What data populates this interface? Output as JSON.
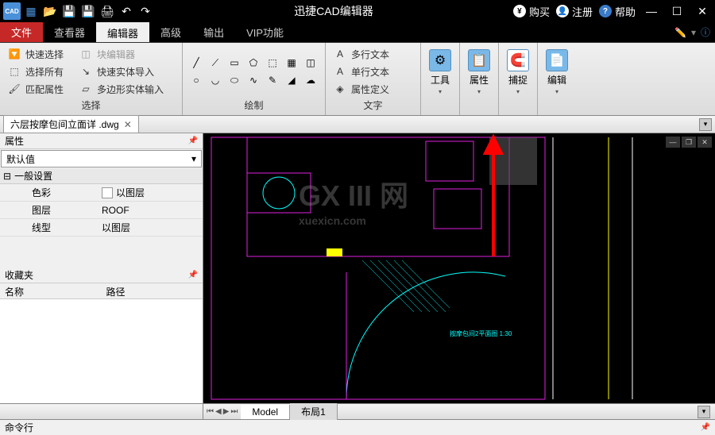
{
  "titlebar": {
    "app_icon": "CAD",
    "title": "迅捷CAD编辑器",
    "buy": "购买",
    "register": "注册",
    "help": "帮助"
  },
  "menu": {
    "file": "文件",
    "viewer": "查看器",
    "editor": "编辑器",
    "advanced": "高级",
    "output": "输出",
    "vip": "VIP功能"
  },
  "ribbon": {
    "select_group": {
      "quick_select": "快速选择",
      "block_editor": "块编辑器",
      "select_all": "选择所有",
      "quick_solid_import": "快速实体导入",
      "match_props": "匹配属性",
      "poly_solid_input": "多边形实体输入",
      "label": "选择"
    },
    "draw_group": {
      "label": "绘制"
    },
    "text_group": {
      "mtext": "多行文本",
      "stext": "单行文本",
      "attr_def": "属性定义",
      "label": "文字"
    },
    "big_buttons": {
      "tools": "工具",
      "props": "属性",
      "snap": "捕捉",
      "edit": "编辑"
    }
  },
  "doctab": {
    "filename": "六层按摩包间立面详 .dwg"
  },
  "properties": {
    "panel_title": "属性",
    "selector": "默认值",
    "section": "一般设置",
    "rows": {
      "color_label": "色彩",
      "color_value": "以图层",
      "layer_label": "图层",
      "layer_value": "ROOF",
      "linetype_label": "线型",
      "linetype_value": "以图层"
    }
  },
  "favorites": {
    "title": "收藏夹",
    "col_name": "名称",
    "col_path": "路径"
  },
  "canvas": {
    "annotation_text": "按摩包间2平面图 1:30"
  },
  "bottom": {
    "model": "Model",
    "layout1": "布局1"
  },
  "cmdline": {
    "label": "命令行"
  }
}
